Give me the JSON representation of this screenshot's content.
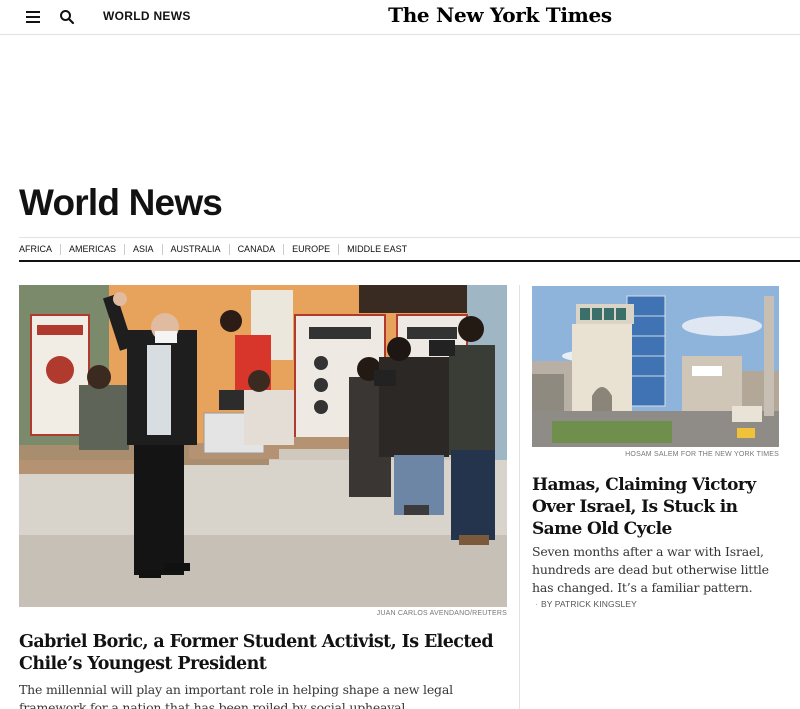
{
  "header": {
    "section_label": "WORLD NEWS",
    "masthead": "The New York Times",
    "icons": [
      "menu-icon",
      "search-icon"
    ]
  },
  "page": {
    "title": "World News"
  },
  "subnav": {
    "items": [
      "AFRICA",
      "AMERICAS",
      "ASIA",
      "AUSTRALIA",
      "CANADA",
      "EUROPE",
      "MIDDLE EAST"
    ]
  },
  "lead_story": {
    "image_credit": "JUAN CARLOS AVENDANO/REUTERS",
    "headline": "Gabriel Boric, a Former Student Activist, Is Elected Chile’s Youngest President",
    "summary": "The millennial will play an important role in helping shape a new legal framework for a nation that has been roiled by social upheaval."
  },
  "side_story": {
    "image_credit": "HOSAM SALEM FOR THE NEW YORK TIMES",
    "headline": "Hamas, Claiming Victory Over Israel, Is Stuck in Same Old Cycle",
    "summary": "Seven months after a war with Israel, hundreds are dead but otherwise little has changed. It’s a familiar pattern.",
    "byline": "By PATRICK KINGSLEY"
  },
  "colors": {
    "text": "#121212",
    "rule": "#e2e2e2",
    "credit": "#777777"
  }
}
